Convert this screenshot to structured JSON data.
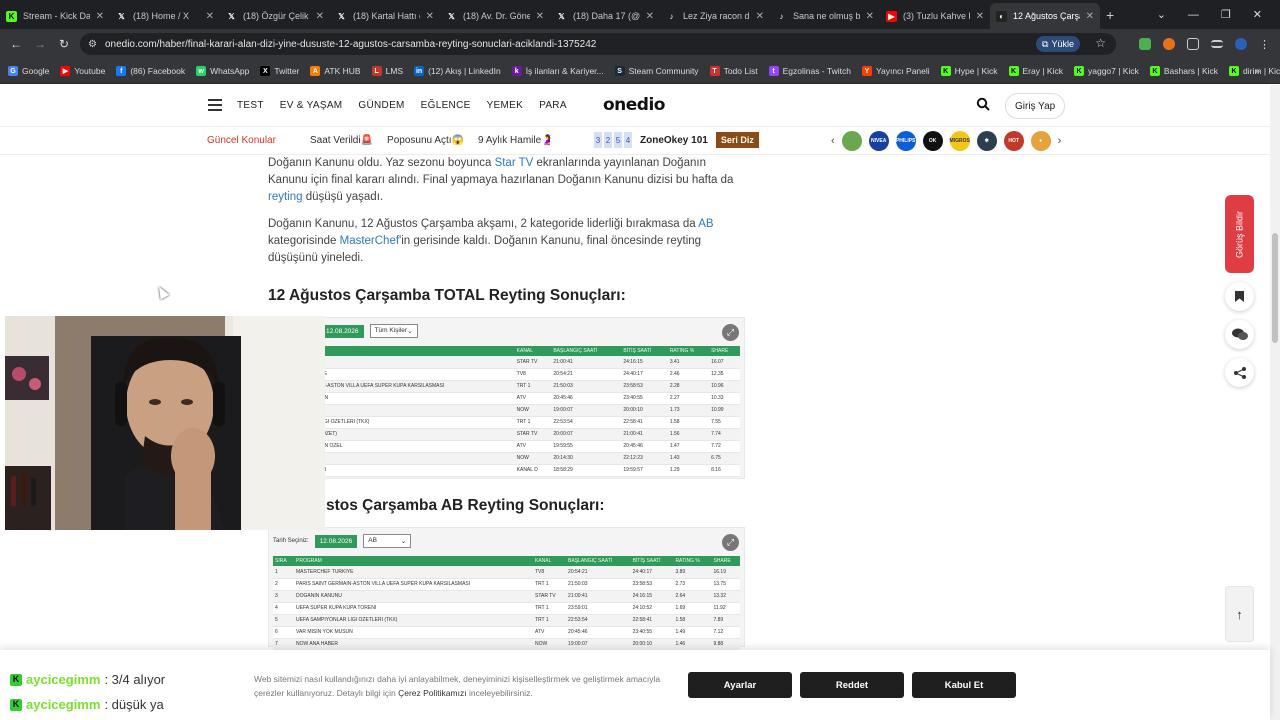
{
  "browser": {
    "tabs": [
      {
        "label": "Stream - Kick Das",
        "icon": "kick-icon",
        "color": "#53fc18"
      },
      {
        "label": "(18) Home / X",
        "icon": "x-icon",
        "color": "#ffffff"
      },
      {
        "label": "(18) Özgür Çelik o",
        "icon": "x-icon",
        "color": "#ffffff"
      },
      {
        "label": "(18) Kartal Hattı o",
        "icon": "x-icon",
        "color": "#ffffff"
      },
      {
        "label": "(18) Av. Dr. Göne",
        "icon": "x-icon",
        "color": "#ffffff"
      },
      {
        "label": "(18) Daha 17 (@d",
        "icon": "x-icon",
        "color": "#ffffff"
      },
      {
        "label": "Lez Ziya racon du",
        "icon": "tiktok-icon",
        "color": "#ffffff"
      },
      {
        "label": "Sana ne olmuş be",
        "icon": "tiktok-icon",
        "color": "#ffffff"
      },
      {
        "label": "(3) Tuzlu Kahve li",
        "icon": "youtube-icon",
        "color": "#ff0000"
      },
      {
        "label": "12 Ağustos Çarşa",
        "icon": "onedio-icon",
        "color": "#222222",
        "active": true
      }
    ],
    "url": "onedio.com/haber/final-karari-alan-dizi-yine-dususte-12-agustos-carsamba-reyting-sonuclari-aciklandi-1375242",
    "install_label": "Yükle",
    "bookmarks": [
      {
        "label": "Google",
        "color": "#4285f4",
        "glyph": "G"
      },
      {
        "label": "Youtube",
        "color": "#ff0000",
        "glyph": "▶"
      },
      {
        "label": "(86) Facebook",
        "color": "#1877f2",
        "glyph": "f"
      },
      {
        "label": "WhatsApp",
        "color": "#25d366",
        "glyph": "w"
      },
      {
        "label": "Twitter",
        "color": "#000000",
        "glyph": "X"
      },
      {
        "label": "ATK HUB",
        "color": "#ff7a00",
        "glyph": "A"
      },
      {
        "label": "LMS",
        "color": "#c0392b",
        "glyph": "L"
      },
      {
        "label": "(12) Akış | LinkedIn",
        "color": "#0a66c2",
        "glyph": "in"
      },
      {
        "label": "İş ilanları & Kariyer...",
        "color": "#6a1b9a",
        "glyph": "k"
      },
      {
        "label": "Steam Community",
        "color": "#1b2838",
        "glyph": "S"
      },
      {
        "label": "Todo List",
        "color": "#d32f2f",
        "glyph": "T"
      },
      {
        "label": "Egzolinas - Twitch",
        "color": "#9146ff",
        "glyph": "t"
      },
      {
        "label": "Yayıncı Paneli",
        "color": "#ff3d00",
        "glyph": "Y"
      },
      {
        "label": "Hype | Kick",
        "color": "#53fc18",
        "glyph": "K"
      },
      {
        "label": "Eray | Kick",
        "color": "#53fc18",
        "glyph": "K"
      },
      {
        "label": "yaggo7 | Kick",
        "color": "#53fc18",
        "glyph": "K"
      },
      {
        "label": "Bashars | Kick",
        "color": "#53fc18",
        "glyph": "K"
      },
      {
        "label": "dirim | Kick",
        "color": "#53fc18",
        "glyph": "K"
      }
    ]
  },
  "site": {
    "menu": [
      "TEST",
      "EV & YAŞAM",
      "GÜNDEM",
      "EĞLENCE",
      "YEMEK",
      "PARA"
    ],
    "logo": "onedio",
    "login": "Giriş Yap",
    "guncel": "Güncel Konular",
    "topics": [
      "Saat Verildi🚨",
      "Poposunu Açtı😱",
      "9 Aylık Hamile🤰"
    ],
    "zone_nums": [
      "3",
      "2",
      "5",
      "4"
    ],
    "zone_name": "ZoneOkey 101",
    "seri": "Seri Diz",
    "brands": [
      {
        "name": "tree-brand",
        "color": "#6aa84f",
        "label": ""
      },
      {
        "name": "nivea-brand",
        "color": "#1a3fa3",
        "label": "NIVEA"
      },
      {
        "name": "philips-brand",
        "color": "#0b5ed7",
        "label": "PHILIPS"
      },
      {
        "name": "ok-brand",
        "color": "#111111",
        "label": "OK"
      },
      {
        "name": "migros-brand",
        "color": "#f5c518",
        "label": "MIGROS"
      },
      {
        "name": "star-brand",
        "color": "#2c3e50",
        "label": "✱"
      },
      {
        "name": "hot-brand",
        "color": "#c0392b",
        "label": "HOT"
      },
      {
        "name": "food-brand",
        "color": "#e6a23c",
        "label": "●"
      }
    ]
  },
  "article": {
    "p1_pre": "Doğanın Kanunu oldu. Yaz sezonu boyunca ",
    "p1_link1": "Star TV",
    "p1_mid": " ekranlarında yayınlanan Doğanın Kanunu için final kararı alındı. Final yapmaya hazırlanan Doğanın Kanunu dizisi bu hafta da ",
    "p1_link2": "reyting",
    "p1_post": " düşüşü yaşadı.",
    "p2_pre": "Doğanın Kanunu, 12 Ağustos Çarşamba akşamı, 2 kategoride liderliği bırakmasa da ",
    "p2_link1": "AB",
    "p2_mid": " kategorisinde ",
    "p2_link2": "MasterChef",
    "p2_post": "'in gerisinde kaldı. Doğanın Kanunu, final öncesinde reyting düşüşünü yineledi.",
    "h_total": "12 Ağustos Çarşamba TOTAL Reyting Sonuçları:",
    "h_ab_visible": "stos Çarşamba AB Reyting Sonuçları:"
  },
  "table_total": {
    "date": "12.08.2026",
    "filter": "Tüm Kişiler",
    "columns": [
      "SIRA",
      "PROGRAM",
      "KANAL",
      "BAŞLANGIÇ SAATİ",
      "BİTİŞ SAATİ",
      "RATING %",
      "SHARE"
    ],
    "rows": [
      [
        "",
        "KANUNU",
        "STAR TV",
        "21:00:41",
        "24:16:15",
        "3.41",
        "16.07"
      ],
      [
        "",
        "EF TURKIYE",
        "TV8",
        "20:54:21",
        "24:40:17",
        "2.46",
        "12.35"
      ],
      [
        "",
        "T GERMAIN-ASTON VILLA UEFA SUPER KUPA KARSILASMASI",
        "TRT 1",
        "21:50:03",
        "23:58:53",
        "2.28",
        "10.96"
      ],
      [
        "",
        "YOK MUSUN",
        "ATV",
        "20:45:46",
        "23:40:55",
        "2.27",
        "10.33"
      ],
      [
        "",
        "HABER",
        "NOW",
        "19:00:07",
        "20:00:10",
        "1.73",
        "10.99"
      ],
      [
        "",
        "YONLAR LIGI OZETLERI (TKX)",
        "TRT 1",
        "22:53:54",
        "22:58:41",
        "1.58",
        "7.55"
      ],
      [
        "",
        "KANUNU (OZET)",
        "STAR TV",
        "20:00:07",
        "21:00:41",
        "1.56",
        "7.74"
      ],
      [
        "",
        "YOK MUSUN OZEL",
        "ATV",
        "19:59:55",
        "20:45:46",
        "1.47",
        "7.72"
      ],
      [
        "",
        "K (T.S)",
        "NOW",
        "20:14:30",
        "22:12:23",
        "1.43",
        "6.75"
      ],
      [
        "",
        "ANA HABER",
        "KANAL D",
        "18:58:29",
        "19:59:57",
        "1.29",
        "8.16"
      ]
    ]
  },
  "table_ab": {
    "date_label": "Tarih Seçiniz:",
    "date": "12.08.2026",
    "filter": "AB",
    "columns": [
      "SIRA",
      "PROGRAM",
      "KANAL",
      "BAŞLANGIÇ SAATİ",
      "BİTİŞ SAATİ",
      "RATING %",
      "SHARE"
    ],
    "rows": [
      [
        "1",
        "MASTERCHEF TURKIYE",
        "TV8",
        "20:54:21",
        "24:40:17",
        "3.89",
        "16.19"
      ],
      [
        "2",
        "PARIS SAINT GERMAIN-ASTON VILLA UEFA SUPER KUPA KARSILASMASI",
        "TRT 1",
        "21:50:03",
        "23:58:53",
        "2.73",
        "13.75"
      ],
      [
        "3",
        "DOGANIN KANUNU",
        "STAR TV",
        "21:00:41",
        "24:16:15",
        "2.64",
        "13.32"
      ],
      [
        "4",
        "UEFA SUPER KUPA KUPA TORENI",
        "TRT 1",
        "23:59:01",
        "24:10:52",
        "1.69",
        "11.92"
      ],
      [
        "5",
        "UEFA SAMPIYONLAR LIGI OZETLERI (TKX)",
        "TRT 1",
        "22:53:54",
        "22:58:41",
        "1.58",
        "7.89"
      ],
      [
        "6",
        "VAR MISIN YOK MUSUN",
        "ATV",
        "20:45:46",
        "23:40:55",
        "1.49",
        "7.12"
      ],
      [
        "7",
        "NOW ANA HABER",
        "NOW",
        "19:00:07",
        "20:00:10",
        "1.46",
        "9.88"
      ]
    ]
  },
  "side": {
    "feedback": "Görüş Bildir"
  },
  "cookie": {
    "text_pre": "Web sitemizi nasıl kullandığınızı daha iyi anlayabilmek, deneyiminizi kişiselleştirmek ve geliştirmek amacıyla çerezler kullanıyoruz. Detaylı bilgi için ",
    "link": "Çerez Politikamızı",
    "text_post": " inceleyebilirsiniz.",
    "settings": "Ayarlar",
    "reject": "Reddet",
    "accept": "Kabul Et"
  },
  "chat": [
    {
      "user": "aycicegimm",
      "msg": ": 3/4 alıyor"
    },
    {
      "user": "aycicegimm",
      "msg": ": düşük ya"
    }
  ]
}
